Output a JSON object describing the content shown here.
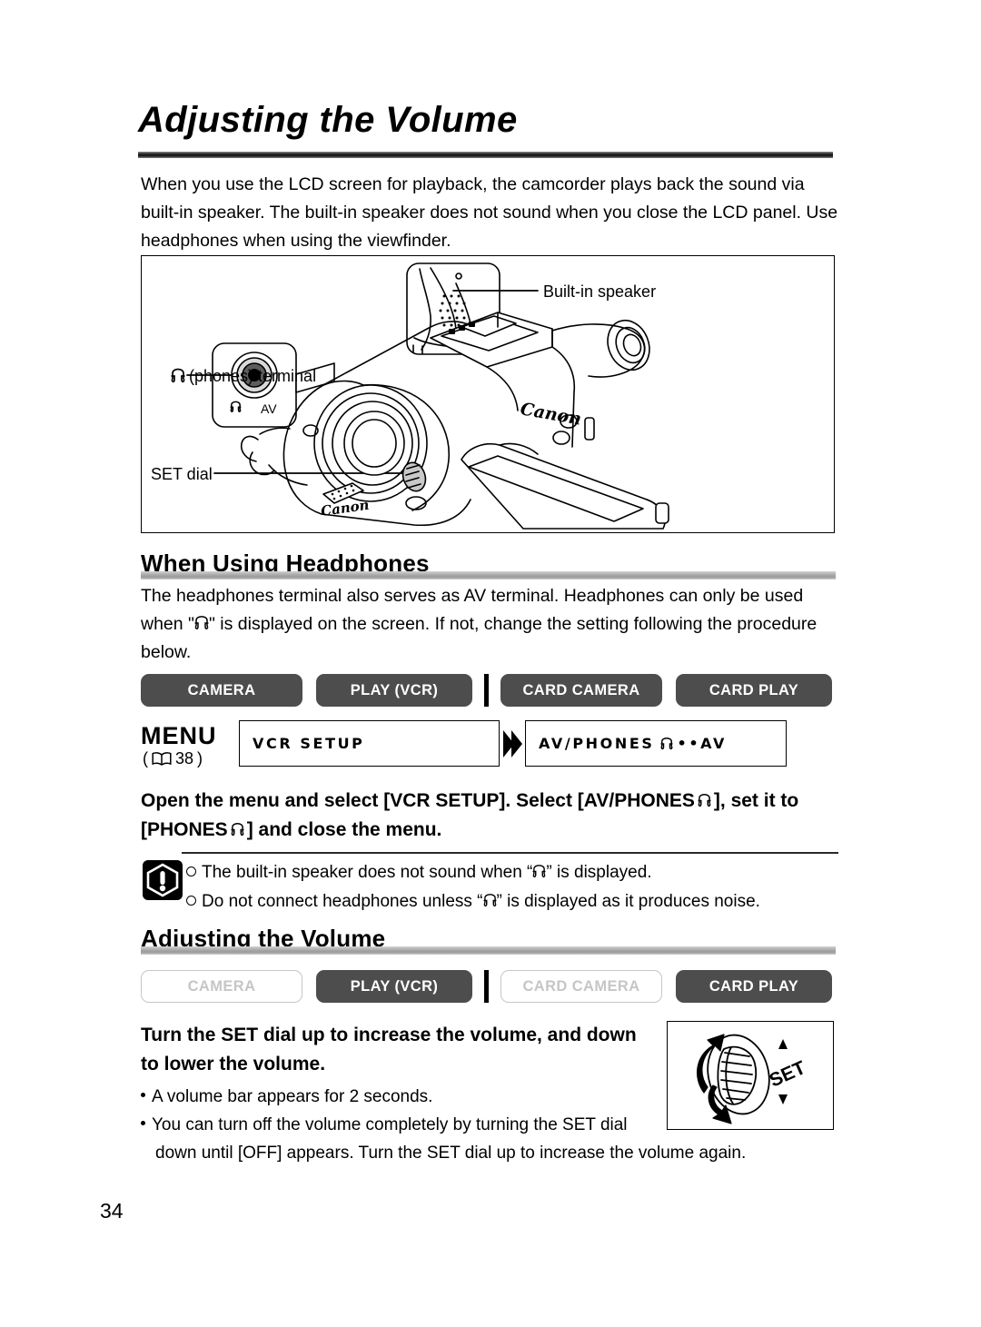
{
  "page": {
    "number": "34",
    "title": "Adjusting the Volume"
  },
  "intro": {
    "paragraph": "When you use the LCD screen for playback, the camcorder plays back the sound via built-in speaker. The built-in speaker does not sound when you close the LCD panel. Use headphones when using the viewfinder."
  },
  "figure": {
    "callouts": {
      "speaker": "Built-in speaker",
      "phones_terminal": "(phones) terminal",
      "set_dial": "SET dial"
    },
    "labels": {
      "jack_phones": "",
      "jack_av": "AV",
      "brand": "Canon"
    }
  },
  "headphones_section": {
    "heading": "When Using Headphones",
    "paragraph_1": "The headphones terminal also serves as AV terminal. Headphones can only be used when \"",
    "paragraph_2": "\" is displayed on the screen. If not, change the setting following the procedure below.",
    "modes": [
      {
        "label": "CAMERA",
        "enabled": true
      },
      {
        "label": "PLAY (VCR)",
        "enabled": true
      },
      {
        "label": "CARD CAMERA",
        "enabled": true
      },
      {
        "label": "CARD PLAY",
        "enabled": true
      }
    ],
    "menu": {
      "word": "MENU",
      "ref_open": "(",
      "ref_page": "38",
      "ref_close": ")",
      "box_1": "VCR SETUP",
      "box_2_prefix": "AV/PHONES",
      "box_2_suffix": "••AV"
    },
    "instruction_1": "Open the menu and select [VCR SETUP]. Select [AV/PHONES",
    "instruction_2": "], set it to [PHONES",
    "instruction_3": "] and close the menu.",
    "notes": {
      "note_1_a": "The built-in speaker does not sound when “",
      "note_1_b": "” is displayed.",
      "note_2_a": "Do not connect headphones unless “",
      "note_2_b": "” is displayed as it produces noise."
    }
  },
  "volume_section": {
    "heading": "Adjusting the Volume",
    "modes": [
      {
        "label": "CAMERA",
        "enabled": false
      },
      {
        "label": "PLAY (VCR)",
        "enabled": true
      },
      {
        "label": "CARD CAMERA",
        "enabled": false
      },
      {
        "label": "CARD PLAY",
        "enabled": true
      }
    ],
    "instruction": "Turn the SET dial up to increase the volume, and down to lower the volume.",
    "bullets": {
      "bullet_1": "A volume bar appears for 2 seconds.",
      "bullet_2_line_1": "You can turn off the volume completely by turning the SET dial",
      "bullet_2_line_2": "down until [OFF] appears. Turn the SET dial up to increase the volume again."
    },
    "setdial_figure": {
      "label": "SET"
    }
  },
  "colors": {
    "mode_on_bg": "#4d4d4d",
    "mode_off_border": "#c6c6c6",
    "mode_off_text": "#c6c6c6",
    "rule_dark": "#111111",
    "rule_light": "#a8a8a8"
  }
}
